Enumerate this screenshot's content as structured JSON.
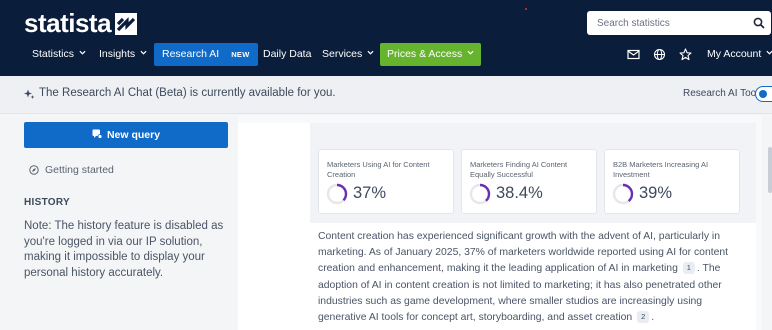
{
  "header": {
    "logo_text": "statista",
    "search_placeholder": "Search statistics",
    "nav": {
      "statistics": "Statistics",
      "insights": "Insights",
      "research_ai": "Research AI",
      "research_ai_badge": "NEW",
      "daily_data": "Daily Data",
      "services": "Services",
      "prices_access": "Prices & Access",
      "my_account": "My Account"
    },
    "icons": [
      "envelope-icon",
      "globe-icon",
      "star-icon",
      "search-icon"
    ]
  },
  "banner": {
    "message": "The Research AI Chat (Beta) is currently available for you.",
    "tool_label": "Research AI Tool",
    "toggle_on": true
  },
  "sidebar": {
    "new_query_label": "New query",
    "getting_started_label": "Getting started",
    "history_title": "HISTORY",
    "history_note": "Note: The history feature is disabled as you're logged in via our IP solution, making it impossible to display your personal history accurately."
  },
  "stats": [
    {
      "label": "Marketers Using AI for Content Creation",
      "value": "37%",
      "fraction": 0.37
    },
    {
      "label": "Marketers Finding AI Content Equally Successful",
      "value": "38.4%",
      "fraction": 0.384
    },
    {
      "label": "B2B Marketers Increasing AI Investment",
      "value": "39%",
      "fraction": 0.39
    }
  ],
  "content": {
    "part1": "Content creation has experienced significant growth with the advent of AI, particularly in marketing. As of January 2025, 37% of marketers worldwide reported using AI for content creation and enhancement, making it the leading application of AI in marketing",
    "cite1": "1",
    "part2": ". The adoption of AI in content creation is not limited to marketing; it has also penetrated other industries such as game development, where smaller studios are increasingly using generative AI tools for concept art, storyboarding, and asset creation",
    "cite2": "2",
    "part3": "."
  },
  "colors": {
    "header_bg": "#0a1d3a",
    "accent_blue": "#0f6ac8",
    "accent_green": "#66b32e",
    "ring_purple": "#6a2fb3"
  }
}
